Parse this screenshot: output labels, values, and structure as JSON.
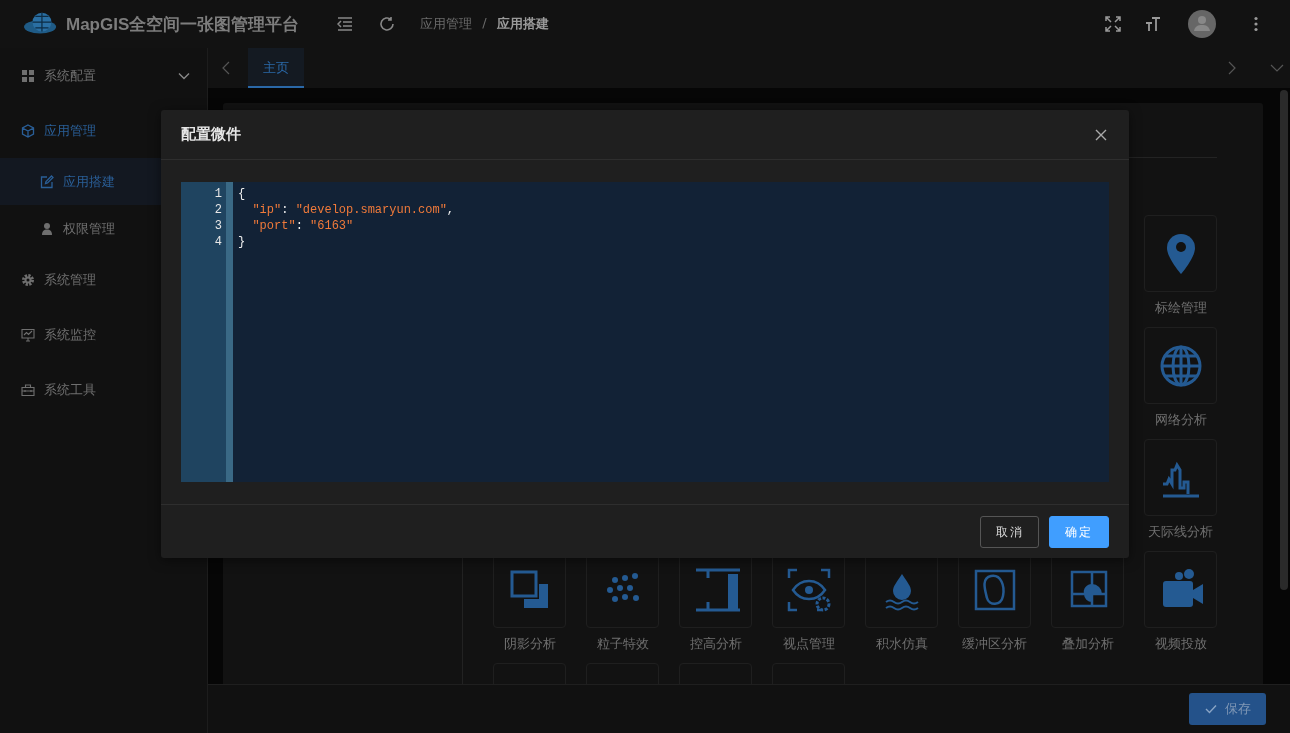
{
  "header": {
    "title": "MapGIS全空间一张图管理平台",
    "breadcrumb": [
      {
        "label": "应用管理",
        "current": false
      },
      {
        "label": "/",
        "current": false
      },
      {
        "label": "应用搭建",
        "current": true
      }
    ]
  },
  "sidebar": {
    "items": [
      {
        "label": "系统配置",
        "selected": false,
        "expanded": false
      },
      {
        "label": "应用管理",
        "selected": true,
        "expanded": true,
        "children": [
          {
            "label": "应用搭建",
            "selected": true
          },
          {
            "label": "权限管理",
            "selected": false
          }
        ]
      },
      {
        "label": "系统管理",
        "selected": false
      },
      {
        "label": "系统监控",
        "selected": false
      },
      {
        "label": "系统工具",
        "selected": false
      }
    ]
  },
  "tabs": [
    {
      "label": "主页",
      "selected": true
    }
  ],
  "widgets": [
    {
      "label": "标绘管理"
    },
    {
      "label": "网络分析"
    },
    {
      "label": "天际线分析"
    },
    {
      "label": "阴影分析"
    },
    {
      "label": "粒子特效"
    },
    {
      "label": "控高分析"
    },
    {
      "label": "视点管理"
    },
    {
      "label": "积水仿真"
    },
    {
      "label": "缓冲区分析"
    },
    {
      "label": "叠加分析"
    },
    {
      "label": "视频投放"
    }
  ],
  "dialog": {
    "title": "配置微件",
    "code_lines": [
      {
        "number": "1",
        "text": "{"
      },
      {
        "number": "2",
        "text": "  \"ip\": \"develop.smaryun.com\","
      },
      {
        "number": "3",
        "text": "  \"port\": \"6163\""
      },
      {
        "number": "4",
        "text": "}"
      }
    ],
    "buttons": [
      {
        "label": "取消",
        "primary": false
      },
      {
        "label": "确定",
        "primary": true
      }
    ]
  },
  "footer": {
    "save_button": "保存"
  }
}
